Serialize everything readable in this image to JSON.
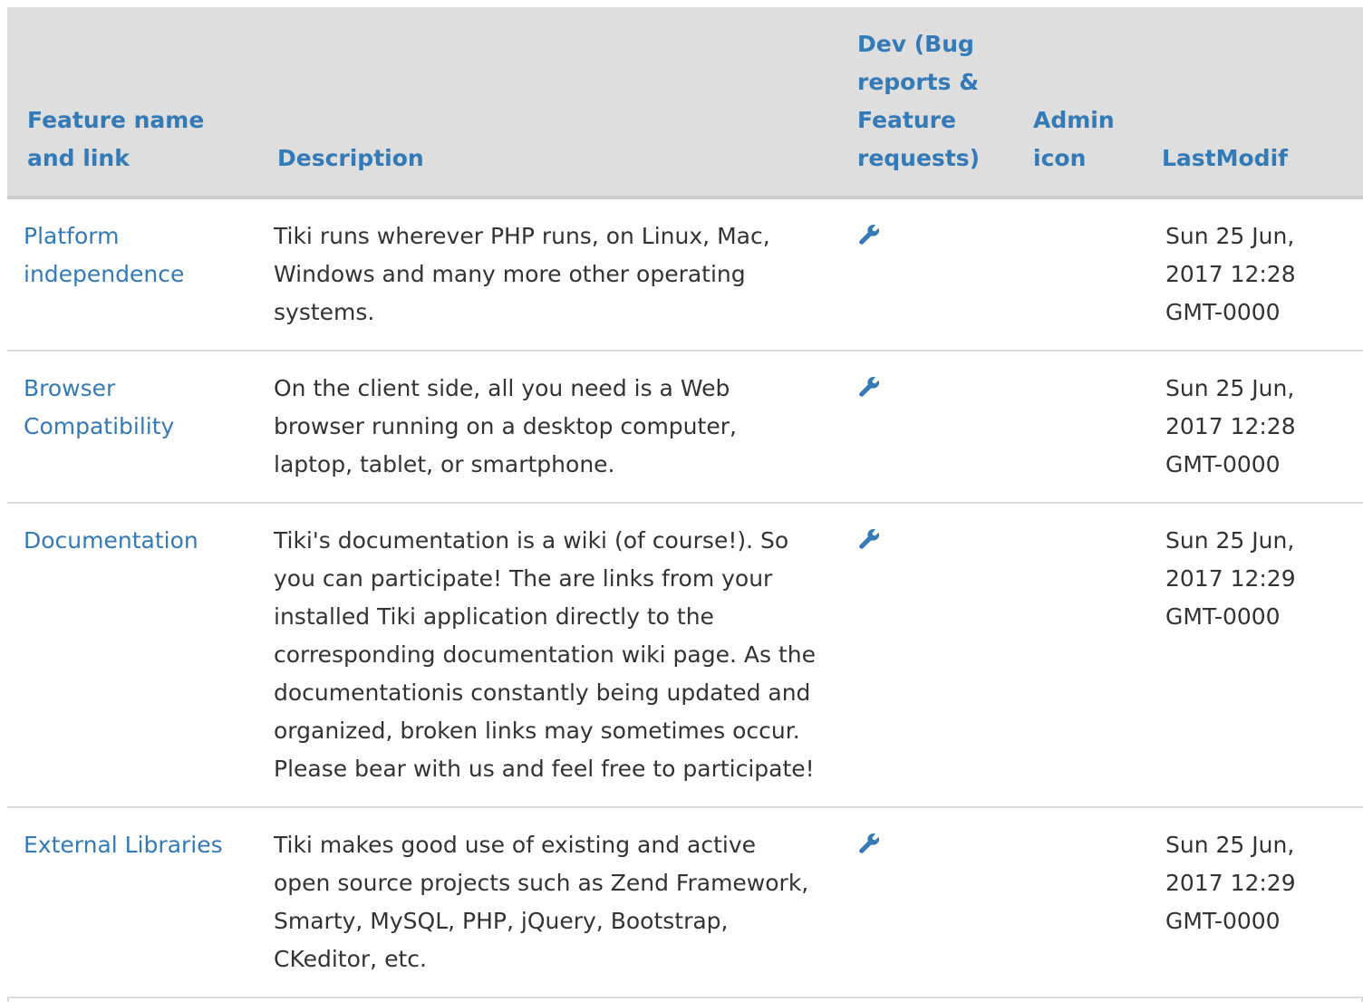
{
  "table": {
    "headers": {
      "feature": "Feature name and link",
      "description": "Description",
      "dev": "Dev (Bug reports & Feature requests)",
      "admin": "Admin icon",
      "lastmodif": "LastModif"
    },
    "rows": [
      {
        "name": "Platform independence",
        "description": "Tiki runs wherever PHP runs, on Linux, Mac, Windows and many more other operating systems.",
        "dev_icon": "wrench-icon",
        "admin": "",
        "lastmodif": "Sun 25 Jun, 2017 12:28 GMT-0000"
      },
      {
        "name": "Browser Compatibility",
        "description": "On the client side, all you need is a Web browser running on a desktop computer, laptop, tablet, or smartphone.",
        "dev_icon": "wrench-icon",
        "admin": "",
        "lastmodif": "Sun 25 Jun, 2017 12:28 GMT-0000"
      },
      {
        "name": "Documentation",
        "description": "Tiki's documentation is a wiki (of course!). So you can participate! The are links from your installed Tiki application directly to the corresponding documentation wiki page. As the documentationis constantly being updated and organized, broken links may sometimes occur. Please bear with us and feel free to participate!",
        "dev_icon": "wrench-icon",
        "admin": "",
        "lastmodif": "Sun 25 Jun, 2017 12:29 GMT-0000"
      },
      {
        "name": "External Libraries",
        "description": "Tiki makes good use of existing and active open source projects such as Zend Framework, Smarty, MySQL, PHP, jQuery, Bootstrap, CKeditor, etc.",
        "dev_icon": "wrench-icon",
        "admin": "",
        "lastmodif": "Sun 25 Jun, 2017 12:29 GMT-0000"
      }
    ]
  },
  "colors": {
    "link": "#337ab7",
    "header_bg": "#dedede",
    "text": "#333333",
    "border": "#dddddd"
  }
}
